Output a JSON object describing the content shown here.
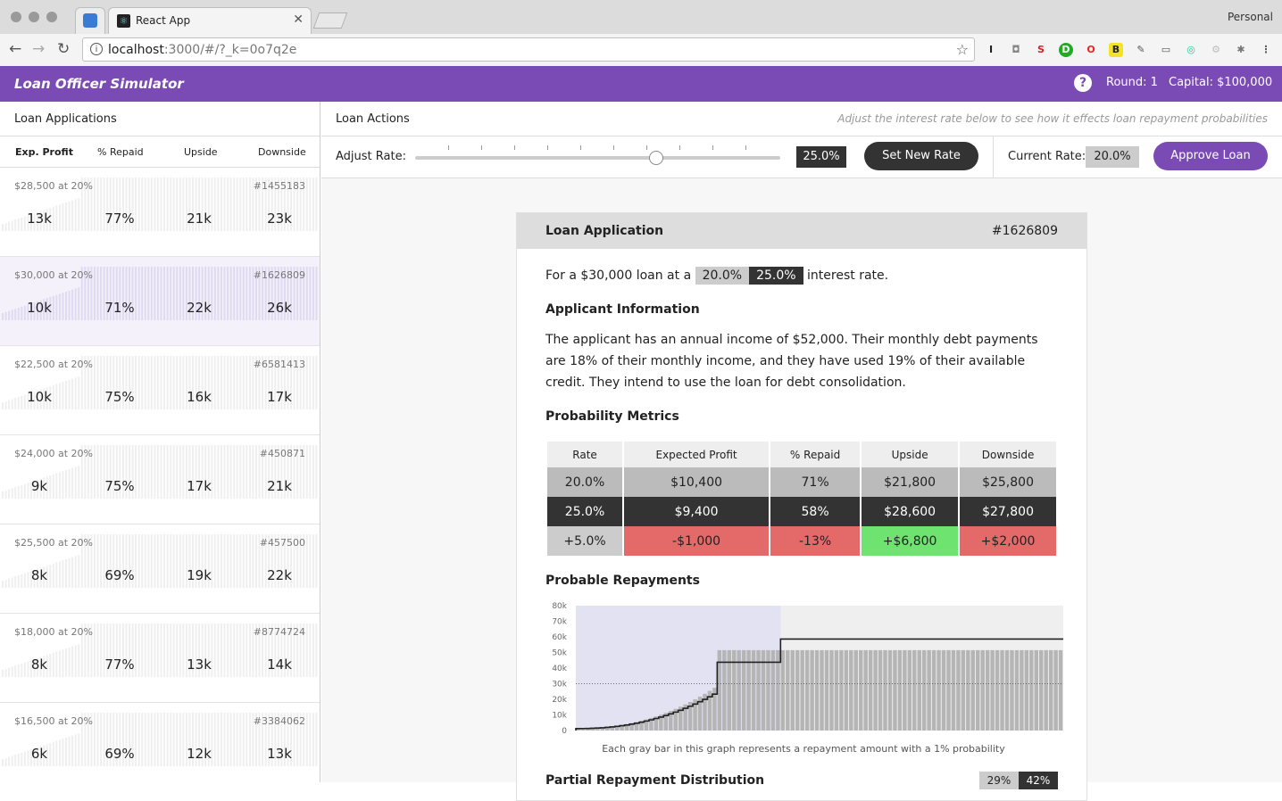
{
  "browser": {
    "tab_title": "React App",
    "profile": "Personal",
    "url_host": "localhost",
    "url_rest": ":3000/#/?_k=0o7q2e"
  },
  "app": {
    "title": "Loan Officer Simulator",
    "round": "Round: 1",
    "capital": "Capital: $100,000"
  },
  "sidebar": {
    "title": "Loan Applications",
    "columns": [
      "Exp. Profit",
      "% Repaid",
      "Upside",
      "Downside"
    ],
    "loans": [
      {
        "amount": "$28,500 at 20%",
        "id": "#1455183",
        "profit": "13k",
        "repaid": "77%",
        "upside": "21k",
        "downside": "23k"
      },
      {
        "amount": "$30,000 at 20%",
        "id": "#1626809",
        "profit": "10k",
        "repaid": "71%",
        "upside": "22k",
        "downside": "26k"
      },
      {
        "amount": "$22,500 at 20%",
        "id": "#6581413",
        "profit": "10k",
        "repaid": "75%",
        "upside": "16k",
        "downside": "17k"
      },
      {
        "amount": "$24,000 at 20%",
        "id": "#450871",
        "profit": "9k",
        "repaid": "75%",
        "upside": "17k",
        "downside": "21k"
      },
      {
        "amount": "$25,500 at 20%",
        "id": "#457500",
        "profit": "8k",
        "repaid": "69%",
        "upside": "19k",
        "downside": "22k"
      },
      {
        "amount": "$18,000 at 20%",
        "id": "#8774724",
        "profit": "8k",
        "repaid": "77%",
        "upside": "13k",
        "downside": "14k"
      },
      {
        "amount": "$16,500 at 20%",
        "id": "#3384062",
        "profit": "6k",
        "repaid": "69%",
        "upside": "12k",
        "downside": "13k"
      }
    ]
  },
  "actions": {
    "title": "Loan Actions",
    "hint": "Adjust the interest rate below to see how it effects loan repayment probabilities",
    "adjust_label": "Adjust Rate:",
    "slider_value": "25.0%",
    "set_button": "Set New Rate",
    "current_label": "Current Rate:",
    "current_value": "20.0%",
    "approve_button": "Approve Loan"
  },
  "application": {
    "title": "Loan Application",
    "id": "#1626809",
    "intro_prefix": "For a $30,000 loan at a",
    "intro_old_rate": "20.0%",
    "intro_new_rate": "25.0%",
    "intro_suffix": "interest rate.",
    "applicant_heading": "Applicant Information",
    "applicant_text": "The applicant has an annual income of $52,000. Their monthly debt payments are 18% of their monthly income, and they have used 19% of their available credit. They intend to use the loan for debt consolidation.",
    "metrics_heading": "Probability Metrics",
    "metrics_headers": [
      "Rate",
      "Expected Profit",
      "% Repaid",
      "Upside",
      "Downside"
    ],
    "metrics_row_current": [
      "20.0%",
      "$10,400",
      "71%",
      "$21,800",
      "$25,800"
    ],
    "metrics_row_new": [
      "25.0%",
      "$9,400",
      "58%",
      "$28,600",
      "$27,800"
    ],
    "metrics_row_diff": [
      "+5.0%",
      "-$1,000",
      "-13%",
      "+$6,800",
      "+$2,000"
    ],
    "diff_colors": [
      "#cccccc",
      "#e46a6a",
      "#e46a6a",
      "#6fe36f",
      "#e46a6a"
    ],
    "repayments_heading": "Probable Repayments",
    "chart_caption": "Each gray bar in this graph represents a repayment amount with a 1% probability",
    "partial_heading": "Partial Repayment Distribution",
    "partial_old": "29%",
    "partial_new": "42%"
  },
  "chart_data": {
    "type": "bar",
    "ylabel_ticks": [
      "0",
      "10k",
      "20k",
      "30k",
      "40k",
      "50k",
      "60k",
      "70k",
      "80k"
    ],
    "ylim": [
      0,
      80000
    ],
    "x_count": 100,
    "repaid_fraction": 0.58,
    "loan_amount": 30000,
    "full_repayment": 51500,
    "cumulative_max": 58600,
    "accent_shade": "#e3e2f3"
  }
}
